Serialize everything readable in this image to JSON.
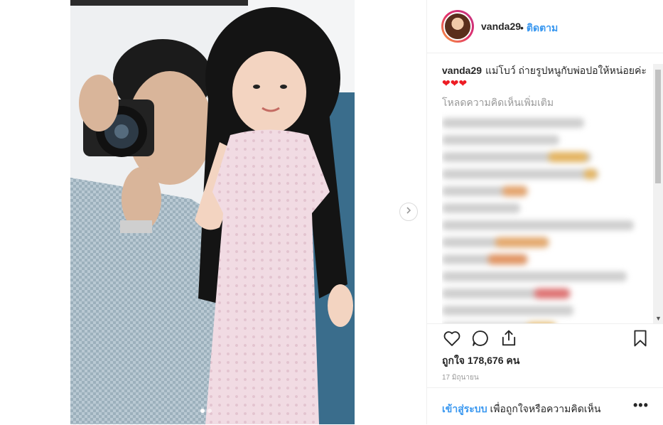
{
  "post": {
    "username": "vanda29",
    "separator": "•",
    "follow_label": "ติดตาม",
    "caption_user": "vanda29",
    "caption_text": "แม่โบว์ ถ่ายรูปหนูกับพ่อปอให้หน่อยค่ะ",
    "caption_emoji": "❤❤❤",
    "load_more": "โหลดความคิดเห็นเพิ่มเติม",
    "likes_text": "ถูกใจ 178,676 คน",
    "date_text": "17 มิถุนายน",
    "login_link": "เข้าสู่ระบบ",
    "login_rest": " เพื่อถูกใจหรือความคิดเห็น",
    "more_options": "•••"
  },
  "icons": {
    "like": "heart-icon",
    "comment": "comment-icon",
    "share": "share-icon",
    "save": "bookmark-icon",
    "next": "chevron-right-icon"
  },
  "colors": {
    "link": "#3897f0",
    "heart": "#ed1c24",
    "muted": "#999999"
  }
}
